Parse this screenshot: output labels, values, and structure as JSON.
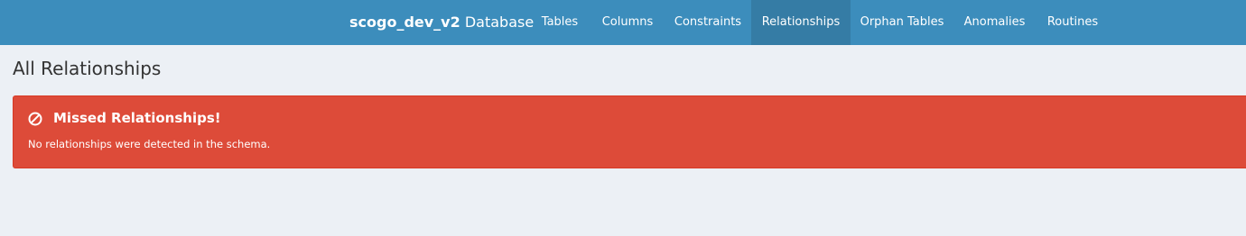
{
  "navbar": {
    "brand_db": "scogo_dev_v2",
    "brand_suffix": "Database",
    "items": [
      {
        "label": "Tables"
      },
      {
        "label": "Columns"
      },
      {
        "label": "Constraints"
      },
      {
        "label": "Relationships",
        "active": true
      },
      {
        "label": "Orphan Tables"
      },
      {
        "label": "Anomalies"
      },
      {
        "label": "Routines"
      }
    ],
    "colors": {
      "background": "#3c8dbc",
      "active_background": "#357ca5",
      "text": "#ffffff"
    }
  },
  "page": {
    "title": "All Relationships",
    "background": "#ecf0f5"
  },
  "callout": {
    "icon": "ban-icon",
    "title": "Missed Relationships!",
    "text": "No relationships were detected in the schema.",
    "color": "#dd4b39"
  }
}
